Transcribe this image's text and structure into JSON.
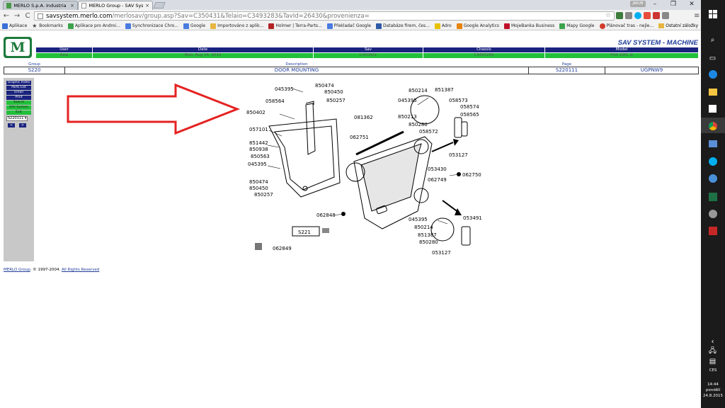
{
  "browser": {
    "tabs": [
      {
        "title": "MERLO S.p.A. Industria M"
      },
      {
        "title": "MERLO Group - SAV Syste"
      }
    ],
    "user_chip": "JAKUB",
    "url_host": "savsystem.merlo.com",
    "url_path": "/merlosav/group.asp?Sav=C350431&Telaio=C3493283&TavId=26430&provenienza=",
    "bookmarks": [
      {
        "label": "Aplikace",
        "color": "#3b6fd8"
      },
      {
        "label": "Bookmarks",
        "color": "#444444"
      },
      {
        "label": "Aplikace pro Androi...",
        "color": "#3ca34b"
      },
      {
        "label": "Synchronizace Chro...",
        "color": "#4a7be0"
      },
      {
        "label": "Google",
        "color": "#4a7be0"
      },
      {
        "label": "Importováno z aplik...",
        "color": "#e7b541"
      },
      {
        "label": "Holmer | Terra-Parts...",
        "color": "#b22222"
      },
      {
        "label": "Překladač Google",
        "color": "#4a7be0"
      },
      {
        "label": "Databáze firem, čes...",
        "color": "#2e5aa8"
      },
      {
        "label": "Adro",
        "color": "#e8c200"
      },
      {
        "label": "Google Analytics",
        "color": "#e8830c"
      },
      {
        "label": "MojeBanka Business",
        "color": "#c0102a"
      },
      {
        "label": "Mapy Google",
        "color": "#3ca34b"
      },
      {
        "label": "Plánovač tras - nejle...",
        "color": "#d23c2a"
      }
    ],
    "other_bookmarks": "Ostatní záložky"
  },
  "header": {
    "title": "SAV SYSTEM - MACHINE",
    "logo_text": "M",
    "columns": [
      {
        "label": "User",
        "value": "Asia"
      },
      {
        "label": "Date",
        "value": "Mon, Aug 24, 2015"
      },
      {
        "label": "Sav",
        "value": "C350431"
      },
      {
        "label": "Chassis",
        "value": "C3493283"
      },
      {
        "label": "Model",
        "value": "P34.10PL G"
      }
    ]
  },
  "group_row": {
    "group_label": "Group",
    "group_value": "S220",
    "description_label": "Description",
    "description_value": "DOOR MOUNTING",
    "page_label": "Page",
    "page_value": "S220111",
    "code_value": "UGPNW9"
  },
  "sidebar": {
    "buttons": [
      {
        "label": "Graphic Index",
        "style": "blue"
      },
      {
        "label": "Parts List",
        "style": "blue"
      },
      {
        "label": "Email",
        "style": "blue"
      },
      {
        "label": "Print",
        "style": "blue"
      },
      {
        "label": "Search",
        "style": "green"
      },
      {
        "label": "SAV System",
        "style": "green"
      },
      {
        "label": "Exit",
        "style": "green"
      }
    ],
    "page_select": "S220111",
    "prev": "<",
    "next": ">"
  },
  "diagram_labels": {
    "l045395a": "045395",
    "l850474a": "850474",
    "l850450a": "850450",
    "l058564": "058564",
    "l850257a": "850257",
    "l850402": "850402",
    "l057101": "057101",
    "l851442": "851442",
    "l850938": "850938",
    "l850563": "850563",
    "l045395b": "045395",
    "l850474b": "850474",
    "l850450b": "850450",
    "l850257b": "850257",
    "l081362": "081362",
    "l062751": "062751",
    "l062848": "062848",
    "l062849": "062849",
    "lS221": "S221",
    "l850214a": "850214",
    "l851387a": "851387",
    "l045395c": "045395",
    "l058573": "058573",
    "l058574": "058574",
    "l850213": "850213",
    "l058565": "058565",
    "l850280a": "850280",
    "l058572": "058572",
    "l053127a": "053127",
    "l053430": "053430",
    "l062749": "062749",
    "l062750": "062750",
    "l045395d": "045395",
    "l053491": "053491",
    "l850214b": "850214",
    "l851387b": "851387",
    "l850280b": "850280",
    "l053127b": "053127"
  },
  "footer": {
    "company": "MERLO Group",
    "copyright": ". © 1997-2004. ",
    "rights": "All Rights Reserved"
  },
  "taskbar": {
    "language": "CES",
    "time": "14:44",
    "day": "pondělí",
    "date": "24.8.2015"
  }
}
